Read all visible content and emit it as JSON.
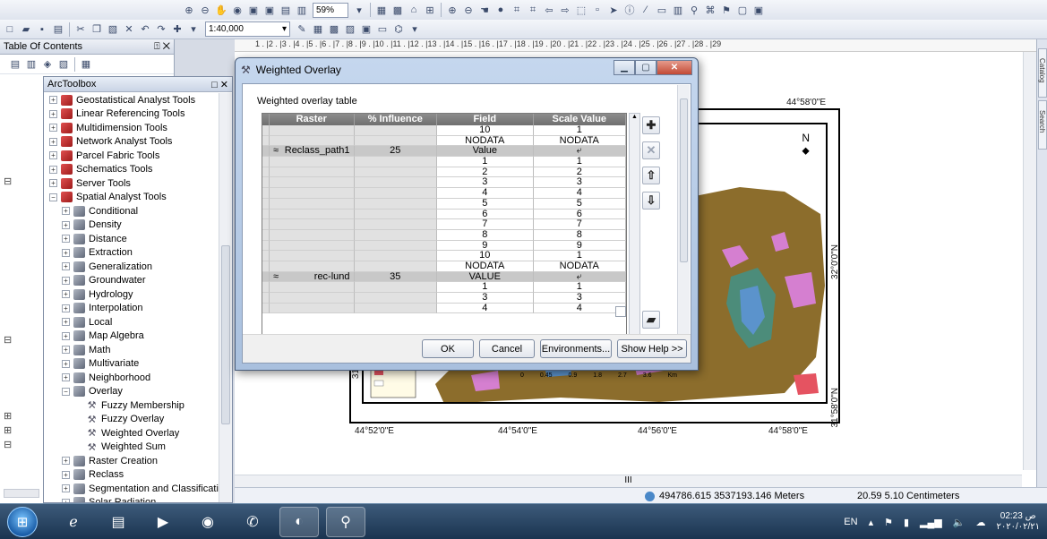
{
  "toolbar": {
    "map_scale": "1:40,000",
    "zoom_percent": "59%"
  },
  "toc": {
    "title": "Table Of Contents",
    "pin": "⍐",
    "close": "✕"
  },
  "toolbox": {
    "title": "ArcToolbox",
    "items": [
      {
        "label": "Geostatistical Analyst Tools",
        "expander": "+",
        "icon": "toolbox-icon",
        "indent": 0
      },
      {
        "label": "Linear Referencing Tools",
        "expander": "+",
        "icon": "toolbox-icon",
        "indent": 0
      },
      {
        "label": "Multidimension Tools",
        "expander": "+",
        "icon": "toolbox-icon",
        "indent": 0
      },
      {
        "label": "Network Analyst Tools",
        "expander": "+",
        "icon": "toolbox-icon",
        "indent": 0
      },
      {
        "label": "Parcel Fabric Tools",
        "expander": "+",
        "icon": "toolbox-icon",
        "indent": 0
      },
      {
        "label": "Schematics Tools",
        "expander": "+",
        "icon": "toolbox-icon",
        "indent": 0
      },
      {
        "label": "Server Tools",
        "expander": "+",
        "icon": "toolbox-icon",
        "indent": 0
      },
      {
        "label": "Spatial Analyst Tools",
        "expander": "−",
        "icon": "toolbox-icon",
        "indent": 0
      },
      {
        "label": "Conditional",
        "expander": "+",
        "icon": "toolset-icon",
        "indent": 1
      },
      {
        "label": "Density",
        "expander": "+",
        "icon": "toolset-icon",
        "indent": 1
      },
      {
        "label": "Distance",
        "expander": "+",
        "icon": "toolset-icon",
        "indent": 1
      },
      {
        "label": "Extraction",
        "expander": "+",
        "icon": "toolset-icon",
        "indent": 1
      },
      {
        "label": "Generalization",
        "expander": "+",
        "icon": "toolset-icon",
        "indent": 1
      },
      {
        "label": "Groundwater",
        "expander": "+",
        "icon": "toolset-icon",
        "indent": 1
      },
      {
        "label": "Hydrology",
        "expander": "+",
        "icon": "toolset-icon",
        "indent": 1
      },
      {
        "label": "Interpolation",
        "expander": "+",
        "icon": "toolset-icon",
        "indent": 1
      },
      {
        "label": "Local",
        "expander": "+",
        "icon": "toolset-icon",
        "indent": 1
      },
      {
        "label": "Map Algebra",
        "expander": "+",
        "icon": "toolset-icon",
        "indent": 1
      },
      {
        "label": "Math",
        "expander": "+",
        "icon": "toolset-icon",
        "indent": 1
      },
      {
        "label": "Multivariate",
        "expander": "+",
        "icon": "toolset-icon",
        "indent": 1
      },
      {
        "label": "Neighborhood",
        "expander": "+",
        "icon": "toolset-icon",
        "indent": 1
      },
      {
        "label": "Overlay",
        "expander": "−",
        "icon": "toolset-icon",
        "indent": 1
      },
      {
        "label": "Fuzzy Membership",
        "expander": "",
        "icon": "hammer-icon",
        "indent": 2
      },
      {
        "label": "Fuzzy Overlay",
        "expander": "",
        "icon": "hammer-icon",
        "indent": 2
      },
      {
        "label": "Weighted Overlay",
        "expander": "",
        "icon": "hammer-icon",
        "indent": 2
      },
      {
        "label": "Weighted Sum",
        "expander": "",
        "icon": "hammer-icon",
        "indent": 2
      },
      {
        "label": "Raster Creation",
        "expander": "+",
        "icon": "toolset-icon",
        "indent": 1
      },
      {
        "label": "Reclass",
        "expander": "+",
        "icon": "toolset-icon",
        "indent": 1
      },
      {
        "label": "Segmentation and Classificatic",
        "expander": "+",
        "icon": "toolset-icon",
        "indent": 1
      },
      {
        "label": "Solar Radiation",
        "expander": "+",
        "icon": "toolset-icon",
        "indent": 1
      }
    ]
  },
  "map": {
    "ruler_text": "1 . |2 . |3 . |4 . |5 . |6 . |7 . |8 . |9 . |10 . |11 . |12 . |13 . |14 . |15 . |16 . |17 . |18 . |19 . |20 . |21 . |22 . |23 . |24 . |25 . |26 . |27 . |28 . |29",
    "top_lon": "44°58'0\"E",
    "bottom_lons": [
      "44°52'0\"E",
      "44°54'0\"E",
      "44°56'0\"E",
      "44°58'0\"E"
    ],
    "right_lat_top": "32°0'0\"N",
    "right_lat_bottom": "31°58'0\"N",
    "left_lat": "31°58'",
    "north": "N",
    "scale_labels": [
      "0",
      "0.45",
      "0.9",
      "1.8",
      "2.7",
      "3.6"
    ],
    "scale_unit": "Km",
    "hscroll_mark": "III"
  },
  "status": {
    "coordinates": "494786.615  3537193.146 Meters",
    "page_position": "20.59  5.10 Centimeters"
  },
  "dialog": {
    "title": "Weighted Overlay",
    "table_label": "Weighted overlay table",
    "columns": [
      "Raster",
      "% Influence",
      "Field",
      "Scale Value"
    ],
    "rows": [
      {
        "type": "value",
        "field": "10",
        "scale": "1"
      },
      {
        "type": "value",
        "field": "NODATA",
        "scale": "NODATA"
      },
      {
        "type": "group",
        "raster": "Reclass_path1",
        "influence": "25",
        "field": "Value",
        "scale": "⤶"
      },
      {
        "type": "value",
        "field": "1",
        "scale": "1"
      },
      {
        "type": "value",
        "field": "2",
        "scale": "2"
      },
      {
        "type": "value",
        "field": "3",
        "scale": "3"
      },
      {
        "type": "value",
        "field": "4",
        "scale": "4"
      },
      {
        "type": "value",
        "field": "5",
        "scale": "5"
      },
      {
        "type": "value",
        "field": "6",
        "scale": "6"
      },
      {
        "type": "value",
        "field": "7",
        "scale": "7"
      },
      {
        "type": "value",
        "field": "8",
        "scale": "8"
      },
      {
        "type": "value",
        "field": "9",
        "scale": "9"
      },
      {
        "type": "value",
        "field": "10",
        "scale": "1"
      },
      {
        "type": "value",
        "field": "NODATA",
        "scale": "NODATA"
      },
      {
        "type": "group",
        "raster": "rec-lund",
        "influence": "35",
        "field": "VALUE",
        "scale": "⤶"
      },
      {
        "type": "value",
        "field": "1",
        "scale": "1"
      },
      {
        "type": "value",
        "field": "3",
        "scale": "3"
      },
      {
        "type": "value",
        "field": "4",
        "scale": "4"
      }
    ],
    "buttons": {
      "ok": "OK",
      "cancel": "Cancel",
      "environments": "Environments...",
      "show_help": "Show Help >>"
    }
  },
  "taskbar": {
    "language": "EN",
    "time": "02:23 ص",
    "date": "٢٠٢٠/٠٢/٢١"
  },
  "colors": {
    "map_brown": "#8c6d2c",
    "map_pink": "#d57fd0",
    "map_blue": "#5b93cc",
    "map_green": "#4c8c7a",
    "map_red": "#e55361"
  }
}
